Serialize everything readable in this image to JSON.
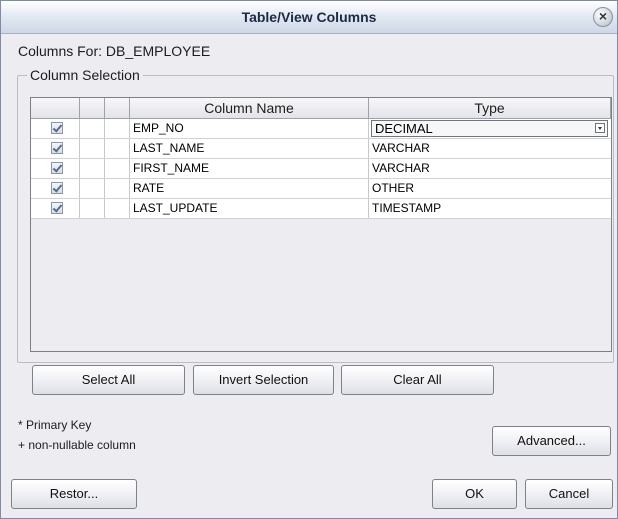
{
  "dialog": {
    "title": "Table/View Columns",
    "columns_for_label": "Columns For: DB_EMPLOYEE",
    "group_label": "Column Selection"
  },
  "table": {
    "headers": [
      "Column Name",
      "Type"
    ],
    "rows": [
      {
        "checked": true,
        "name": "EMP_NO",
        "type": "DECIMAL"
      },
      {
        "checked": true,
        "name": "LAST_NAME",
        "type": "VARCHAR"
      },
      {
        "checked": true,
        "name": "FIRST_NAME",
        "type": "VARCHAR"
      },
      {
        "checked": true,
        "name": "RATE",
        "type": "OTHER"
      },
      {
        "checked": true,
        "name": "LAST_UPDATE",
        "type": "TIMESTAMP"
      }
    ]
  },
  "buttons": {
    "select_all": "Select All",
    "invert_selection": "Invert Selection",
    "clear_all": "Clear All",
    "advanced": "Advanced...",
    "restore": "Restor...",
    "ok": "OK",
    "cancel": "Cancel"
  },
  "legend_notes": {
    "primary_key": "* Primary Key",
    "non_nullable": "+ non-nullable column"
  },
  "icons": {
    "close": "close-icon",
    "dropdown": "chevron-down-icon",
    "checkbox": "checkbox-checked-icon"
  },
  "colors": {
    "dialog_bg": "#ececf1",
    "title_text": "#1c2a44",
    "border": "#7c7f87"
  }
}
